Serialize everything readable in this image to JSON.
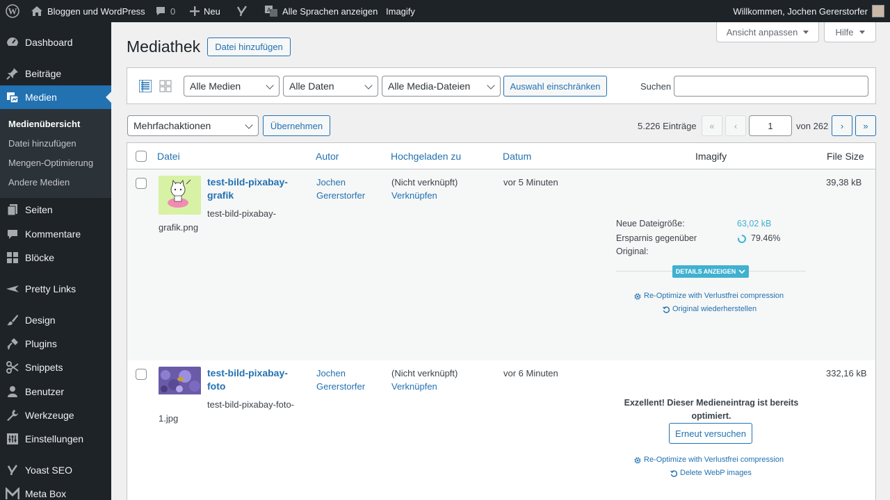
{
  "admin_bar": {
    "site_name": "Bloggen und WordPress",
    "comments_count": "0",
    "new_label": "Neu",
    "languages_label": "Alle Sprachen anzeigen",
    "imagify_label": "Imagify",
    "greeting": "Willkommen, Jochen Gererstorfer"
  },
  "sidebar": {
    "items": [
      {
        "label": "Dashboard",
        "icon": "dashboard-icon"
      },
      {
        "label": "Beiträge",
        "icon": "pin-icon"
      },
      {
        "label": "Medien",
        "icon": "media-icon"
      },
      {
        "label": "Seiten",
        "icon": "page-icon"
      },
      {
        "label": "Kommentare",
        "icon": "comment-icon"
      },
      {
        "label": "Blöcke",
        "icon": "blocks-icon"
      },
      {
        "label": "Pretty Links",
        "icon": "star-icon"
      },
      {
        "label": "Design",
        "icon": "brush-icon"
      },
      {
        "label": "Plugins",
        "icon": "plugin-icon"
      },
      {
        "label": "Snippets",
        "icon": "scissors-icon"
      },
      {
        "label": "Benutzer",
        "icon": "user-icon"
      },
      {
        "label": "Werkzeuge",
        "icon": "wrench-icon"
      },
      {
        "label": "Einstellungen",
        "icon": "settings-icon"
      },
      {
        "label": "Yoast SEO",
        "icon": "yoast-icon"
      },
      {
        "label": "Meta Box",
        "icon": "metabox-icon"
      }
    ],
    "submenu": [
      "Medienübersicht",
      "Datei hinzufügen",
      "Mengen-Optimierung",
      "Andere Medien"
    ]
  },
  "screen_options": {
    "view_label": "Ansicht anpassen",
    "help_label": "Hilfe"
  },
  "page": {
    "title": "Mediathek",
    "add_button": "Datei hinzufügen"
  },
  "filters": {
    "media_type": "Alle Medien",
    "dates": "Alle Daten",
    "media_files": "Alle Media-Dateien",
    "filter_button": "Auswahl einschränken",
    "search_label": "Suchen",
    "search_value": ""
  },
  "bulk": {
    "select": "Mehrfachaktionen",
    "apply": "Übernehmen"
  },
  "pagination": {
    "count": "5.226 Einträge",
    "first": "«",
    "prev": "‹",
    "current_page": "1",
    "of_label": "von 262",
    "next": "›",
    "last": "»"
  },
  "table": {
    "columns": {
      "file": "Datei",
      "author": "Autor",
      "uploaded_to": "Hochgeladen zu",
      "date": "Datum",
      "imagify": "Imagify",
      "size": "File Size"
    },
    "rows": [
      {
        "title_1": "test-bild-pixabay-",
        "title_2": "grafik",
        "filename_1": "test-bild-pixabay-",
        "filename_2": "grafik.png",
        "author_1": "Jochen",
        "author_2": "Gererstorfer",
        "uploaded": "(Nicht verknüpft)",
        "attach": "Verknüpfen",
        "date": "vor 5 Minuten",
        "size": "39,38 kB",
        "imagify": {
          "new_size_label": "Neue Dateigröße:",
          "new_size_value": "63,02 kB",
          "savings_label_1": "Ersparnis gegenüber",
          "savings_label_2": "Original:",
          "savings_value": "79.46%",
          "savings_percent": 79.46,
          "details_button": "DETAILS ANZEIGEN",
          "reoptimize": "Re-Optimize with Verlustfrei compression",
          "restore": "Original wiederherstellen"
        }
      },
      {
        "title_1": "test-bild-pixabay-",
        "title_2": "foto",
        "filename_1": "test-bild-pixabay-foto-",
        "filename_2": "1.jpg",
        "author_1": "Jochen",
        "author_2": "Gererstorfer",
        "uploaded": "(Nicht verknüpft)",
        "attach": "Verknüpfen",
        "date": "vor 6 Minuten",
        "size": "332,16 kB",
        "imagify": {
          "message_1": "Exzellent! Dieser Medieneintrag ist bereits",
          "message_2": "optimiert.",
          "retry_button": "Erneut versuchen",
          "reoptimize": "Re-Optimize with Verlustfrei compression",
          "delete_webp": "Delete WebP images"
        }
      }
    ]
  },
  "colors": {
    "accent": "#2271b1",
    "sidebar_bg": "#1d2327",
    "imagify_teal": "#40b1d0"
  }
}
